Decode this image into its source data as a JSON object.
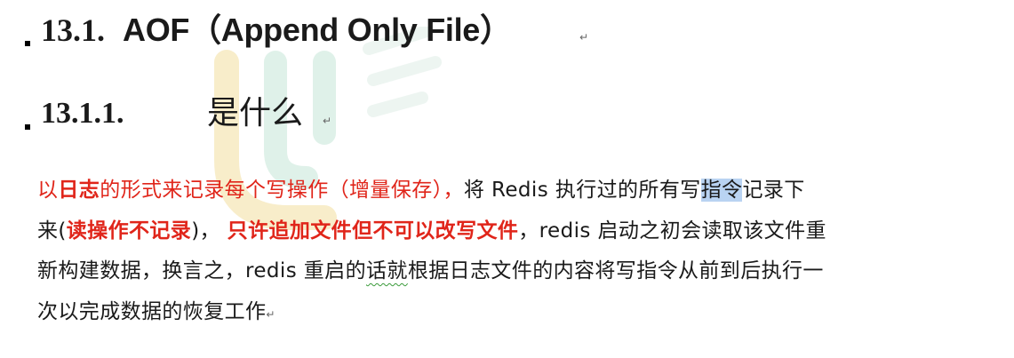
{
  "heading1": {
    "number": "13.1.",
    "title": "AOF（Append Only File）",
    "para_mark": "↵"
  },
  "heading2": {
    "number": "13.1.1.",
    "title": "是什么",
    "para_mark": "↵"
  },
  "paragraph": {
    "l1_a": "以",
    "l1_b": "日志",
    "l1_c": "的形式来记录每个写操作（增量保存），",
    "l1_d": "将 Redis 执行过的所有写",
    "l1_e": "指令",
    "l1_f": "记录下",
    "l2_a": "来(",
    "l2_b": "读操作不记录",
    "l2_c": ")， ",
    "l2_d": "只许追加文件但不可以改写文件",
    "l2_e": "，redis 启动之初会读取该文件重",
    "l3_a": "新构建数据，换言之，redis  重启的",
    "l3_b": "话就",
    "l3_c": "根据日志文件的内容将写指令从前到后执行一",
    "l4_a": "次以完成数据的恢复工作",
    "para_mark": "↵"
  },
  "colors": {
    "accent_red": "#e0251a",
    "selection": "#b9d3f2",
    "spellcheck": "#3a9a3a"
  }
}
